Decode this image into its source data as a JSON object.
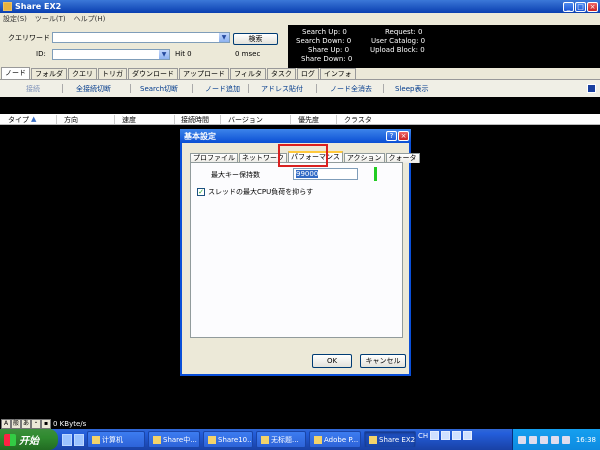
{
  "window": {
    "title": "Share EX2",
    "min_glyph": "_",
    "max_glyph": "□",
    "close_glyph": "×"
  },
  "menu": [
    "設定(S)",
    "ツール(T)",
    "ヘルプ(H)"
  ],
  "search": {
    "keyword_label": "クエリワード",
    "id_label": "ID:",
    "search_button": "検索",
    "hit_text": "Hit 0",
    "msec_text": "0 msec",
    "combo_arrow": "▼"
  },
  "stats": {
    "search_up": "Search Up: 0",
    "search_down": "Search Down: 0",
    "share_up": "Share Up: 0",
    "share_down": "Share Down: 0",
    "request": "Request: 0",
    "user_catalog": "User Catalog: 0",
    "upload_block": "Upload Block: 0"
  },
  "tabs": [
    "ノード",
    "フォルダ",
    "クエリ",
    "トリガ",
    "ダウンロード",
    "アップロード",
    "フィルタ",
    "タスク",
    "ログ",
    "インフォ"
  ],
  "actions": {
    "a1": "接続",
    "a2": "全接続切断",
    "a3": "Search切断",
    "a4": "ノード追加",
    "a5": "アドレス貼付",
    "a6": "ノード全消去",
    "a7": "Sleep表示"
  },
  "columns": [
    "タイプ",
    "方向",
    "速度",
    "接続時間",
    "バージョン",
    "優先度",
    "クラスタ"
  ],
  "sort_glyph": "▲",
  "status": {
    "speed": "0 KByte/s",
    "ime": [
      "A",
      "般",
      "あ",
      "・",
      "▪"
    ]
  },
  "taskbar": {
    "start": "开始",
    "buttons": [
      "计算机",
      "Share中...",
      "Share10...",
      "无标题...",
      "Adobe P...",
      "Share EX2"
    ],
    "lang": "CH",
    "clock": "16:38"
  },
  "dialog": {
    "title": "基本設定",
    "help_glyph": "?",
    "close_glyph": "×",
    "tabs": [
      "プロファイル",
      "ネットワーク",
      "パフォーマンス",
      "アクション",
      "クォータ"
    ],
    "active_tab": "パフォーマンス",
    "max_key_label": "最大キー保持数",
    "max_key_value": "99000",
    "cpu_checkbox_label": "スレッドの最大CPU負荷を抑らす",
    "cpu_checkbox_checked": true,
    "ok_button": "OK",
    "cancel_button": "キャンセル",
    "check_glyph": "✓"
  }
}
